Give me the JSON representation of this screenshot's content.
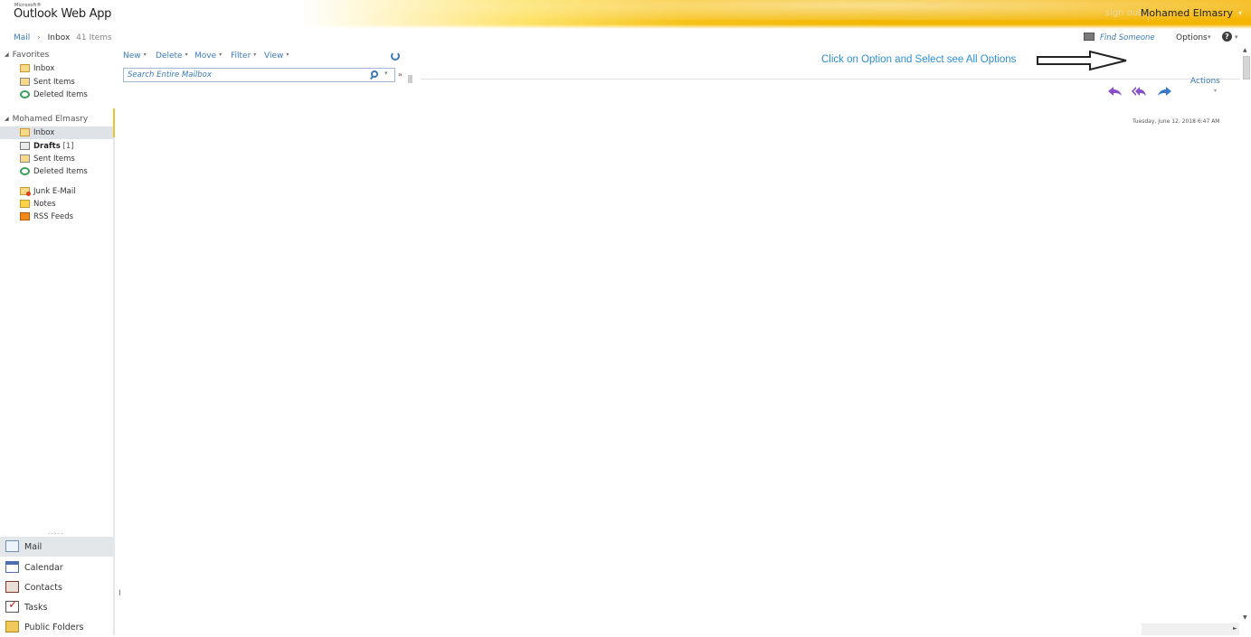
{
  "header": {
    "brand_small": "Microsoft®",
    "brand": "Outlook Web App",
    "sign_out": "sign out",
    "user_name": "Mohamed Elmasry",
    "user_caret": "▾"
  },
  "breadcrumb": {
    "mail": "Mail",
    "separator": "›",
    "folder": "Inbox",
    "count": "41 Items"
  },
  "top_right": {
    "find_someone": "Find Someone",
    "options": "Options",
    "caret": "▾",
    "help": "?"
  },
  "favorites": {
    "title": "Favorites",
    "items": [
      {
        "label": "Inbox",
        "icon": "inbox-icon"
      },
      {
        "label": "Sent Items",
        "icon": "sent-items-icon"
      },
      {
        "label": "Deleted Items",
        "icon": "deleted-items-icon"
      }
    ]
  },
  "mailbox": {
    "title": "Mohamed Elmasry",
    "items": [
      {
        "label": "Inbox",
        "icon": "inbox-icon",
        "selected": true
      },
      {
        "label": "Drafts",
        "unread": "[1]",
        "icon": "drafts-icon"
      },
      {
        "label": "Sent Items",
        "icon": "sent-items-icon"
      },
      {
        "label": "Deleted Items",
        "icon": "deleted-items-icon"
      },
      {
        "label": "Junk E-Mail",
        "icon": "junk-mail-icon"
      },
      {
        "label": "Notes",
        "icon": "notes-icon"
      },
      {
        "label": "RSS Feeds",
        "icon": "rss-feeds-icon"
      }
    ]
  },
  "modules": {
    "dots": ".....",
    "items": [
      {
        "label": "Mail",
        "icon": "mail-icon",
        "active": true
      },
      {
        "label": "Calendar",
        "icon": "calendar-icon"
      },
      {
        "label": "Contacts",
        "icon": "contacts-icon"
      },
      {
        "label": "Tasks",
        "icon": "tasks-icon"
      },
      {
        "label": "Public Folders",
        "icon": "public-folders-icon"
      }
    ]
  },
  "toolbar": {
    "new": "New",
    "delete": "Delete",
    "move": "Move",
    "filter": "Filter",
    "view": "View",
    "caret": "▾"
  },
  "search": {
    "placeholder": "Search Entire Mailbox",
    "expand": "»"
  },
  "reading_pane": {
    "annotation": "Click on Option and Select see All Options",
    "actions": "Actions",
    "actions_caret": "▾",
    "date": "Tuesday, June 12, 2018 6:47 AM",
    "icons": [
      "reply-icon",
      "reply-all-icon",
      "forward-icon"
    ]
  },
  "misc": {
    "splitter": "I",
    "scroll_up": "▲",
    "scroll_down": "▼",
    "scroll_right": "►"
  },
  "colors": {
    "link": "#3b7ab8",
    "annotation": "#2c8fd3",
    "header_gold": "#f4b505",
    "selection": "#dfe2e6"
  }
}
